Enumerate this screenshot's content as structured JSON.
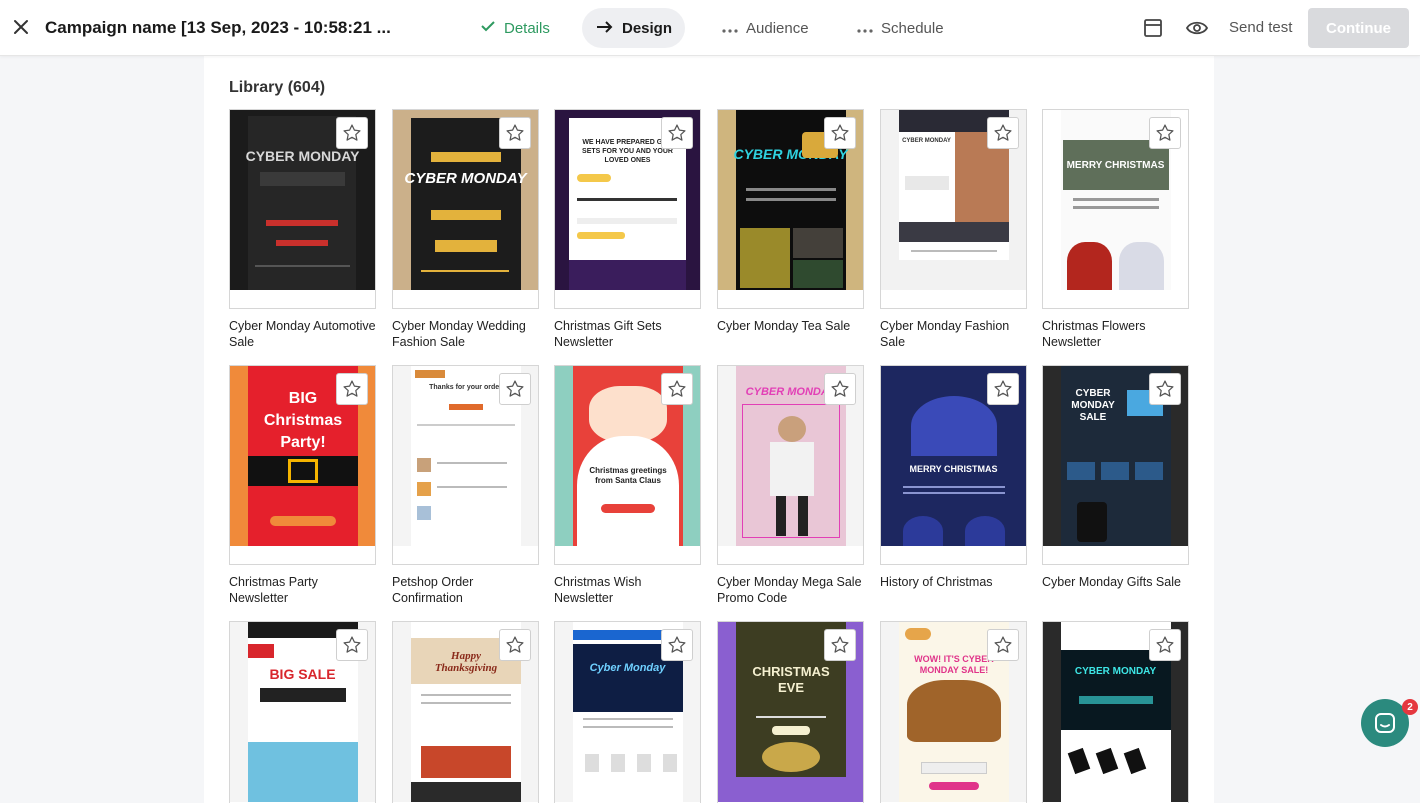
{
  "header": {
    "campaign_title": "Campaign name [13 Sep, 2023 - 10:58:21 ...",
    "steps": [
      {
        "label": "Details",
        "state": "done"
      },
      {
        "label": "Design",
        "state": "active"
      },
      {
        "label": "Audience",
        "state": "pending"
      },
      {
        "label": "Schedule",
        "state": "pending"
      }
    ],
    "send_test_label": "Send test",
    "continue_label": "Continue"
  },
  "library": {
    "heading": "Library (604)",
    "templates": [
      {
        "name": "Cyber Monday Automotive Sale"
      },
      {
        "name": "Cyber Monday Wedding Fashion Sale"
      },
      {
        "name": "Christmas Gift Sets Newsletter"
      },
      {
        "name": "Cyber Monday Tea Sale"
      },
      {
        "name": "Cyber Monday Fashion Sale"
      },
      {
        "name": "Christmas Flowers Newsletter"
      },
      {
        "name": "Christmas Party Newsletter"
      },
      {
        "name": "Petshop Order Confirmation"
      },
      {
        "name": "Christmas Wish Newsletter"
      },
      {
        "name": "Cyber Monday Mega Sale Promo Code"
      },
      {
        "name": "History of Christmas"
      },
      {
        "name": "Cyber Monday Gifts Sale"
      },
      {
        "name": ""
      },
      {
        "name": ""
      },
      {
        "name": ""
      },
      {
        "name": ""
      },
      {
        "name": ""
      },
      {
        "name": ""
      }
    ],
    "preview_text": {
      "t1": "CYBER MONDAY",
      "t2": "CYBER MONDAY",
      "t3": "WE HAVE PREPARED GIFT SETS FOR YOU AND YOUR LOVED ONES",
      "t4": "CYBER MONDAY",
      "t5": "CYBER MONDAY",
      "t6": "MERRY CHRISTMAS",
      "t7": "BIG Christmas Party!",
      "t8": "Thanks for your order",
      "t9": "Christmas greetings from Santa Claus",
      "t10": "CYBER MONDAY",
      "t11": "MERRY CHRISTMAS",
      "t12": "CYBER MONDAY SALE",
      "t13": "BIG SALE",
      "t14": "Happy Thanksgiving",
      "t15": "Cyber Monday",
      "t16": "CHRISTMAS EVE",
      "t17": "WOW! IT'S CYBER MONDAY SALE!",
      "t18": "CYBER MONDAY"
    }
  },
  "chat": {
    "badge_count": "2"
  },
  "colors": {
    "accent_done": "#2e9a60",
    "chat": "#2b8a7e",
    "badge": "#e5373f"
  }
}
